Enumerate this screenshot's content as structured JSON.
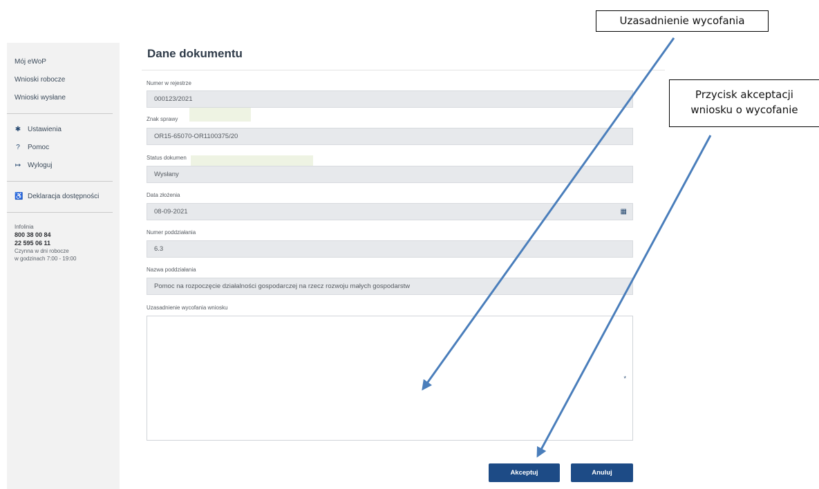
{
  "sidebar": {
    "items": [
      {
        "label": "Mój eWoP"
      },
      {
        "label": "Wnioski robocze"
      },
      {
        "label": "Wnioski wysłane"
      }
    ],
    "settings": {
      "label": "Ustawienia",
      "icon": "gear-icon"
    },
    "help": {
      "label": "Pomoc",
      "icon": "question-circle-icon"
    },
    "logout": {
      "label": "Wyloguj",
      "icon": "sign-out-icon"
    },
    "accessibility": {
      "label": "Deklaracja dostępności",
      "icon": "wheelchair-icon"
    },
    "infoline": {
      "title": "Infolinia",
      "phone1": "800 38 00 84",
      "phone2": "22 595 06 11",
      "hours1": "Czynna w dni robocze",
      "hours2": "w godzinach 7:00 - 19:00"
    }
  },
  "main": {
    "title": "Dane dokumentu",
    "fields": [
      {
        "label": "Numer w rejestrze",
        "value": "000123/2021"
      },
      {
        "label": "Znak sprawy",
        "value": "OR15-65070-OR1100375/20"
      },
      {
        "label": "Status dokumen",
        "value": "Wysłany"
      },
      {
        "label": "Data złożenia",
        "value": "08-09-2021",
        "icon": "calendar-icon"
      },
      {
        "label": "Numer poddziałania",
        "value": "6.3"
      },
      {
        "label": "Nazwa poddziałania",
        "value": "Pomoc na rozpoczęcie działalności gospodarczej na rzecz rozwoju małych gospodarstw"
      }
    ],
    "justification": {
      "label": "Uzasadnienie wycofania wniosku",
      "value": "",
      "required_marker": "*"
    },
    "buttons": {
      "accept": "Akceptuj",
      "cancel": "Anuluj"
    }
  },
  "annotations": {
    "callout1": "Uzasadnienie wycofania",
    "callout2_line1": "Przycisk akceptacji",
    "callout2_line2": "wniosku o wycofanie",
    "arrow_color": "#4a7ebb"
  },
  "colors": {
    "primary": "#1d4b86",
    "sidebar_bg": "#f2f2f2",
    "field_bg": "#e7e9ec"
  }
}
